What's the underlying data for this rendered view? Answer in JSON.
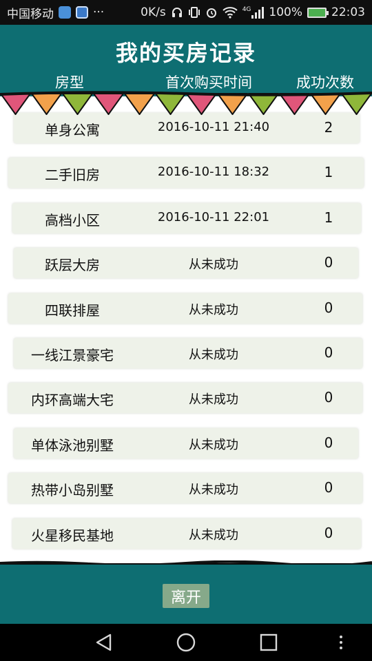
{
  "status_bar": {
    "carrier": "中国移动",
    "icons": [
      "app-badge-icon",
      "app-badge-icon",
      "more-dots-icon",
      "headphones-icon",
      "vibrate-icon",
      "alarm-icon",
      "wifi-icon",
      "signal-4g-icon",
      "battery-icon"
    ],
    "ellipsis": "···",
    "net_speed": "0K/s",
    "network_label": "4G",
    "battery": "100%",
    "time": "22:03"
  },
  "header": {
    "title": "我的买房记录",
    "columns": [
      "房型",
      "首次购买时间",
      "成功次数"
    ]
  },
  "rows": [
    {
      "type": "单身公寓",
      "time": "2016-10-11 21:40",
      "count": "2"
    },
    {
      "type": "二手旧房",
      "time": "2016-10-11 18:32",
      "count": "1"
    },
    {
      "type": "高档小区",
      "time": "2016-10-11 22:01",
      "count": "1"
    },
    {
      "type": "跃层大房",
      "time": "从未成功",
      "count": "0"
    },
    {
      "type": "四联排屋",
      "time": "从未成功",
      "count": "0"
    },
    {
      "type": "一线江景豪宅",
      "time": "从未成功",
      "count": "0"
    },
    {
      "type": "内环高端大宅",
      "time": "从未成功",
      "count": "0"
    },
    {
      "type": "单体泳池别墅",
      "time": "从未成功",
      "count": "0"
    },
    {
      "type": "热带小岛别墅",
      "time": "从未成功",
      "count": "0"
    },
    {
      "type": "火星移民基地",
      "time": "从未成功",
      "count": "0"
    }
  ],
  "footer": {
    "leave_label": "离开"
  },
  "colors": {
    "teal": "#0e6e72",
    "row_bg": "#eef2e9",
    "button": "#86a98a",
    "flags": [
      "#e0567a",
      "#f2a14b",
      "#8fb73a"
    ]
  }
}
